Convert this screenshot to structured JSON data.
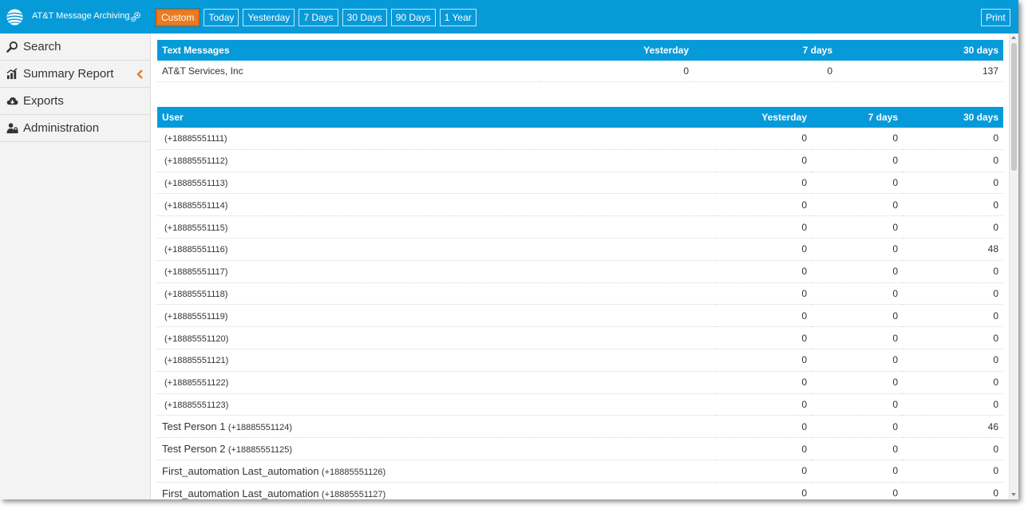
{
  "app": {
    "title": "AT&T Message Archiving"
  },
  "colors": {
    "brand": "#079ad9",
    "accent": "#eb7c1f"
  },
  "toolbar": {
    "ranges": [
      "Custom",
      "Today",
      "Yesterday",
      "7 Days",
      "30 Days",
      "90 Days",
      "1 Year"
    ],
    "active_range": "Custom",
    "print_label": "Print"
  },
  "sidebar": {
    "items": [
      {
        "label": "Search",
        "icon": "search-icon"
      },
      {
        "label": "Summary Report",
        "icon": "bar-chart-icon",
        "active": true
      },
      {
        "label": "Exports",
        "icon": "cloud-download-icon"
      },
      {
        "label": "Administration",
        "icon": "lock-user-icon"
      }
    ]
  },
  "text_messages": {
    "headers": [
      "Text Messages",
      "Yesterday",
      "7 days",
      "30 days"
    ],
    "rows": [
      {
        "name": "AT&T Services, Inc",
        "yesterday": "0",
        "days7": "0",
        "days30": "137"
      }
    ]
  },
  "users": {
    "headers": [
      "User",
      "Yesterday",
      "7 days",
      "30 days"
    ],
    "rows": [
      {
        "name": "",
        "phone": "(+18885551111)",
        "yesterday": "0",
        "days7": "0",
        "days30": "0"
      },
      {
        "name": "",
        "phone": "(+18885551112)",
        "yesterday": "0",
        "days7": "0",
        "days30": "0"
      },
      {
        "name": "",
        "phone": "(+18885551113)",
        "yesterday": "0",
        "days7": "0",
        "days30": "0"
      },
      {
        "name": "",
        "phone": "(+18885551114)",
        "yesterday": "0",
        "days7": "0",
        "days30": "0"
      },
      {
        "name": "",
        "phone": "(+18885551115)",
        "yesterday": "0",
        "days7": "0",
        "days30": "0"
      },
      {
        "name": "",
        "phone": "(+18885551116)",
        "yesterday": "0",
        "days7": "0",
        "days30": "48"
      },
      {
        "name": "",
        "phone": "(+18885551117)",
        "yesterday": "0",
        "days7": "0",
        "days30": "0"
      },
      {
        "name": "",
        "phone": "(+18885551118)",
        "yesterday": "0",
        "days7": "0",
        "days30": "0"
      },
      {
        "name": "",
        "phone": "(+18885551119)",
        "yesterday": "0",
        "days7": "0",
        "days30": "0"
      },
      {
        "name": "",
        "phone": "(+18885551120)",
        "yesterday": "0",
        "days7": "0",
        "days30": "0"
      },
      {
        "name": "",
        "phone": "(+18885551121)",
        "yesterday": "0",
        "days7": "0",
        "days30": "0"
      },
      {
        "name": "",
        "phone": "(+18885551122)",
        "yesterday": "0",
        "days7": "0",
        "days30": "0"
      },
      {
        "name": "",
        "phone": "(+18885551123)",
        "yesterday": "0",
        "days7": "0",
        "days30": "0"
      },
      {
        "name": "Test Person 1",
        "phone": "(+18885551124)",
        "yesterday": "0",
        "days7": "0",
        "days30": "46"
      },
      {
        "name": "Test Person 2",
        "phone": "(+18885551125)",
        "yesterday": "0",
        "days7": "0",
        "days30": "0"
      },
      {
        "name": "First_automation Last_automation",
        "phone": "(+18885551126)",
        "yesterday": "0",
        "days7": "0",
        "days30": "0"
      },
      {
        "name": "First_automation Last_automation",
        "phone": "(+18885551127)",
        "yesterday": "0",
        "days7": "0",
        "days30": "0"
      }
    ]
  }
}
